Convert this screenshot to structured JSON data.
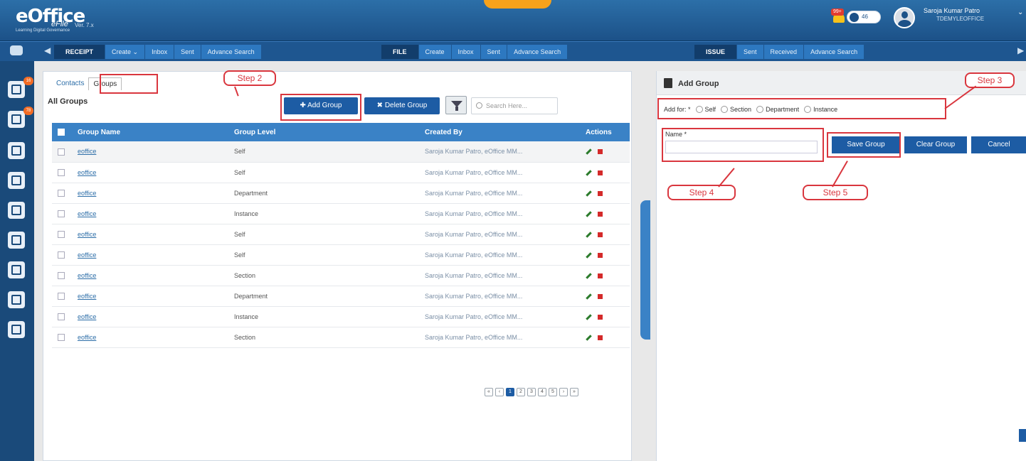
{
  "header": {
    "logo_main": "eOffice",
    "logo_tagline": "Learning Digital Governance",
    "logo_product": "eFile",
    "logo_version": "Ver. 7.x",
    "bell_badge": "99+",
    "toggle_label": "46",
    "user_name": "Saroja Kumar Patro",
    "user_code": "TDEMYLEOFFICE",
    "caret": "⌄"
  },
  "menubar": {
    "left_arrow": "◀",
    "right_arrow": "▶",
    "groups": [
      {
        "lead": "RECEIPT",
        "items": [
          "Create ⌄",
          "Inbox",
          "Sent",
          "Advance Search"
        ]
      },
      {
        "lead": "FILE",
        "items": [
          "Create",
          "Inbox",
          "Sent",
          "Advance Search"
        ]
      },
      {
        "lead": "ISSUE",
        "items": [
          "Sent",
          "Received",
          "Advance Search"
        ]
      }
    ]
  },
  "sidebar": {
    "badges": [
      "16",
      "78"
    ]
  },
  "tabs": [
    "Contacts",
    "Groups"
  ],
  "section_title": "All Groups",
  "toolbar": {
    "add_label": "✚  Add Group",
    "delete_label": "✖  Delete Group",
    "search_placeholder": "Search Here..."
  },
  "table": {
    "headers": [
      "Group Name",
      "Group Level",
      "Created By",
      "Actions"
    ],
    "rows": [
      {
        "name": "eoffice",
        "level": "Self",
        "creator": "Saroja Kumar Patro, eOffice MM..."
      },
      {
        "name": "eoffice",
        "level": "Self",
        "creator": "Saroja Kumar Patro, eOffice MM..."
      },
      {
        "name": "eoffice",
        "level": "Department",
        "creator": "Saroja Kumar Patro, eOffice MM..."
      },
      {
        "name": "eoffice",
        "level": "Instance",
        "creator": "Saroja Kumar Patro, eOffice MM..."
      },
      {
        "name": "eoffice",
        "level": "Self",
        "creator": "Saroja Kumar Patro, eOffice MM..."
      },
      {
        "name": "eoffice",
        "level": "Self",
        "creator": "Saroja Kumar Patro, eOffice MM..."
      },
      {
        "name": "eoffice",
        "level": "Section",
        "creator": "Saroja Kumar Patro, eOffice MM..."
      },
      {
        "name": "eoffice",
        "level": "Department",
        "creator": "Saroja Kumar Patro, eOffice MM..."
      },
      {
        "name": "eoffice",
        "level": "Instance",
        "creator": "Saroja Kumar Patro, eOffice MM..."
      },
      {
        "name": "eoffice",
        "level": "Section",
        "creator": "Saroja Kumar Patro, eOffice MM..."
      }
    ]
  },
  "pager": [
    "«",
    "‹",
    "1",
    "2",
    "3",
    "4",
    "5",
    "›",
    "»"
  ],
  "add_group": {
    "title": "Add Group",
    "add_for_label": "Add for: *",
    "options": [
      "Self",
      "Section",
      "Department",
      "Instance"
    ],
    "name_label": "Name *",
    "save_label": "Save Group",
    "clear_label": "Clear Group",
    "cancel_label": "Cancel"
  },
  "callouts": {
    "step2": "Step 2",
    "step3": "Step 3",
    "step4": "Step 4",
    "step5": "Step 5"
  },
  "colors": {
    "header_blue": "#1c5188",
    "accent_blue": "#1d5ca4",
    "table_head": "#3a82c6",
    "callout_red": "#d9363e",
    "brand_orange": "#f7a21b"
  }
}
